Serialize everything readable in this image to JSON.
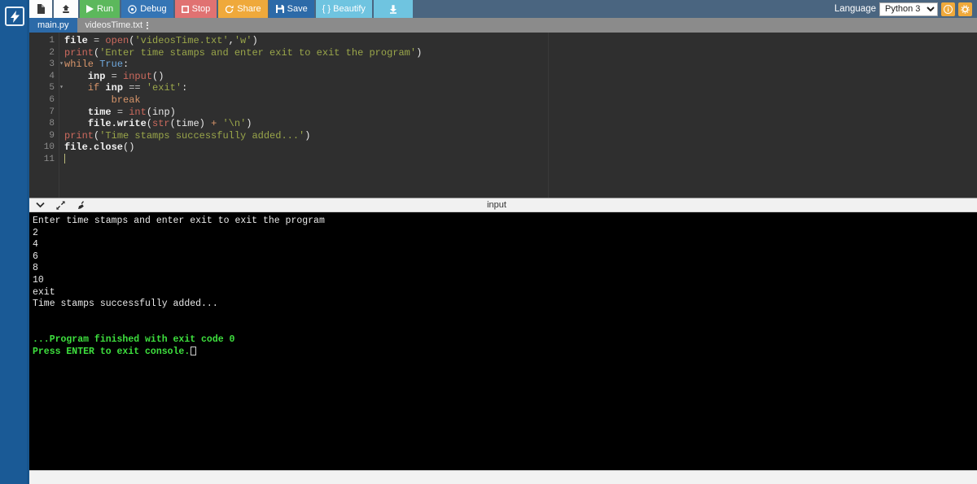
{
  "rail": {
    "logo_icon": "lightning-bolt-icon"
  },
  "toolbar": {
    "new_file_icon": "new-file-icon",
    "upload_icon": "upload-icon",
    "run_label": "Run",
    "debug_label": "Debug",
    "stop_label": "Stop",
    "share_label": "Share",
    "save_label": "Save",
    "beautify_label": "{ } Beautify",
    "download_icon": "download-icon",
    "language_label": "Language",
    "language_value": "Python 3",
    "language_options": [
      "Python 3"
    ],
    "info_icon": "info-icon",
    "settings_icon": "gear-icon",
    "colors": {
      "run": "#5cb85c",
      "debug": "#3575b5",
      "stop": "#e07272",
      "share": "#efa93b",
      "save": "#2c6aa8",
      "beautify": "#6fc4e0",
      "toolbar_bg": "#4a6580"
    }
  },
  "tabs": [
    {
      "label": "main.py",
      "active": true
    },
    {
      "label": "videosTime.txt",
      "active": false,
      "menu_icon": "kebab-menu-icon"
    }
  ],
  "editor": {
    "line_numbers": [
      "1",
      "2",
      "3",
      "4",
      "5",
      "6",
      "7",
      "8",
      "9",
      "10",
      "11"
    ],
    "fold_lines": [
      3,
      5
    ],
    "lines": [
      "file = open('videosTime.txt','w')",
      "print('Enter time stamps and enter exit to exit the program')",
      "while True:",
      "    inp = input()",
      "    if inp == 'exit':",
      "        break",
      "    time = int(inp)",
      "    file.write(str(time) + '\\n')",
      "print('Time stamps successfully added...')",
      "file.close()",
      ""
    ],
    "cursor_line": 11
  },
  "console_bar": {
    "collapse_icon": "chevron-down-icon",
    "expand_icon": "expand-arrows-icon",
    "clear_icon": "broom-icon",
    "title": "input"
  },
  "console": {
    "lines": [
      "Enter time stamps and enter exit to exit the program",
      "2",
      "4",
      "6",
      "8",
      "10",
      "exit",
      "Time stamps successfully added..."
    ],
    "finished_line": "...Program finished with exit code 0",
    "prompt_line": "Press ENTER to exit console.",
    "finished_color": "#3ee03e"
  }
}
